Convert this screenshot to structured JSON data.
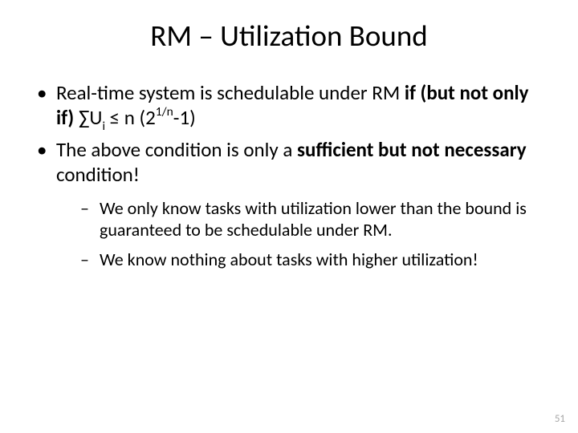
{
  "title": "RM – Utilization Bound",
  "bullets": {
    "b1_pre": "Real-time system is schedulable under RM ",
    "b1_bold": "if (but not only if)",
    "b1_formula_sum": "  ∑U",
    "b1_formula_sub": "i",
    "b1_formula_mid": " ≤ n (2",
    "b1_formula_sup": "1/n",
    "b1_formula_end": "-1)",
    "b2_pre": "The above condition is only a ",
    "b2_bold": "sufficient but not necessary",
    "b2_post": " condition!",
    "s1": " We only know tasks with utilization lower than the bound is guaranteed to be schedulable under RM.",
    "s2": "We know nothing about tasks with higher utilization!"
  },
  "page_number": "51"
}
